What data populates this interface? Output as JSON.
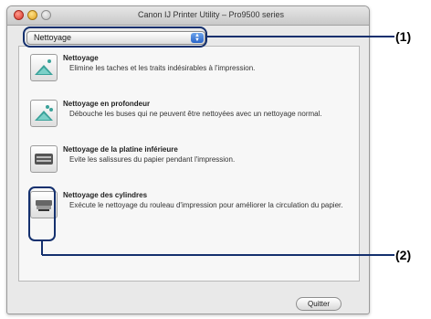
{
  "window": {
    "title": "Canon IJ Printer Utility – Pro9500 series",
    "controls": [
      "close",
      "minimize",
      "zoom"
    ]
  },
  "menu": {
    "selected": "Nettoyage"
  },
  "items": [
    {
      "title": "Nettoyage",
      "desc": "Elimine les taches et les traits indésirables à l'impression.",
      "icon": "nozzle-cleaning-icon"
    },
    {
      "title": "Nettoyage en profondeur",
      "desc": "Débouche les buses qui ne peuvent être nettoyées avec un nettoyage normal.",
      "icon": "deep-cleaning-icon"
    },
    {
      "title": "Nettoyage de la platine inférieure",
      "desc": "Evite les salissures du papier pendant l'impression.",
      "icon": "bottom-plate-cleaning-icon"
    },
    {
      "title": "Nettoyage des cylindres",
      "desc": "Exécute le nettoyage du rouleau d'impression pour améliorer la circulation du papier.",
      "icon": "roller-cleaning-icon"
    }
  ],
  "buttons": {
    "quit": "Quitter"
  },
  "callouts": {
    "one": "(1)",
    "two": "(2)"
  },
  "colors": {
    "callout_line": "#14306e",
    "popup_accent": "#2a64c8",
    "icon_teal": "#3aa29a"
  }
}
